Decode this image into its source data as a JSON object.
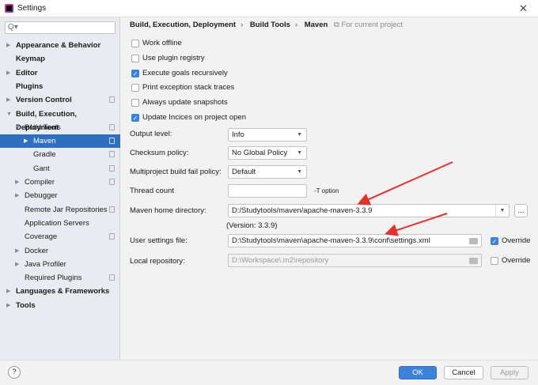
{
  "window": {
    "title": "Settings",
    "close": "✕"
  },
  "sidebar": {
    "search_placeholder": "Q▾",
    "items": [
      {
        "label": "Appearance & Behavior",
        "bold": true,
        "level": 0,
        "arrow": "▶"
      },
      {
        "label": "Keymap",
        "bold": true,
        "level": 0,
        "arrow": ""
      },
      {
        "label": "Editor",
        "bold": true,
        "level": 0,
        "arrow": "▶"
      },
      {
        "label": "Plugins",
        "bold": true,
        "level": 0,
        "arrow": ""
      },
      {
        "label": "Version Control",
        "bold": true,
        "level": 0,
        "arrow": "▶",
        "copy": true
      },
      {
        "label": "Build, Execution, Deployment",
        "bold": true,
        "level": 0,
        "arrow": "▼"
      },
      {
        "label": "Build Tools",
        "level": 1,
        "arrow": "▼",
        "copy": true
      },
      {
        "label": "Maven",
        "level": 2,
        "arrow": "▶",
        "copy": true,
        "selected": true
      },
      {
        "label": "Gradle",
        "level": 2,
        "arrow": "",
        "copy": true
      },
      {
        "label": "Gant",
        "level": 2,
        "arrow": "",
        "copy": true
      },
      {
        "label": "Compiler",
        "level": 1,
        "arrow": "▶",
        "copy": true
      },
      {
        "label": "Debugger",
        "level": 1,
        "arrow": "▶"
      },
      {
        "label": "Remote Jar Repositories",
        "level": 1,
        "arrow": "",
        "copy": true
      },
      {
        "label": "Application Servers",
        "level": 1,
        "arrow": ""
      },
      {
        "label": "Coverage",
        "level": 1,
        "arrow": "",
        "copy": true
      },
      {
        "label": "Docker",
        "level": 1,
        "arrow": "▶"
      },
      {
        "label": "Java Profiler",
        "level": 1,
        "arrow": "▶"
      },
      {
        "label": "Required Plugins",
        "level": 1,
        "arrow": "",
        "copy": true
      },
      {
        "label": "Languages & Frameworks",
        "bold": true,
        "level": 0,
        "arrow": "▶"
      },
      {
        "label": "Tools",
        "bold": true,
        "level": 0,
        "arrow": "▶"
      }
    ]
  },
  "breadcrumb": {
    "items": [
      "Build, Execution, Deployment",
      "Build Tools",
      "Maven"
    ],
    "sep": "›",
    "scope": "For current project"
  },
  "checkboxes": [
    {
      "label": "Work offline",
      "checked": false
    },
    {
      "label": "Use plugin registry",
      "checked": false
    },
    {
      "label": "Execute goals recursively",
      "checked": true
    },
    {
      "label": "Print exception stack traces",
      "checked": false
    },
    {
      "label": "Always update snapshots",
      "checked": false
    },
    {
      "label": "Update Incices on project open",
      "checked": true
    }
  ],
  "form": {
    "output_level": {
      "label": "Output level:",
      "value": "Info"
    },
    "checksum": {
      "label": "Checksum policy:",
      "value": "No Global Policy"
    },
    "fail_policy": {
      "label": "Multiproject build fail policy:",
      "value": "Default"
    },
    "thread_count": {
      "label": "Thread count",
      "value": "",
      "hint": "-T option"
    },
    "maven_home": {
      "label": "Maven home directory:",
      "value": "D:/Studytools/maven/apache-maven-3.3.9",
      "browse": "...",
      "version": "(Version: 3.3.9)"
    },
    "user_settings": {
      "label": "User settings file:",
      "value": "D:\\Studytools\\maven\\apache-maven-3.3.9\\conf\\settings.xml",
      "override_label": "Override",
      "override": true
    },
    "local_repo": {
      "label": "Local repository:",
      "value": "D:\\Workspace\\.m2\\repository",
      "override_label": "Override",
      "override": false
    }
  },
  "footer": {
    "help": "?",
    "ok": "OK",
    "cancel": "Cancel",
    "apply": "Apply"
  },
  "colors": {
    "accent": "#3d82d6",
    "selection": "#2f6fbf",
    "annotation": "#e8302a"
  }
}
